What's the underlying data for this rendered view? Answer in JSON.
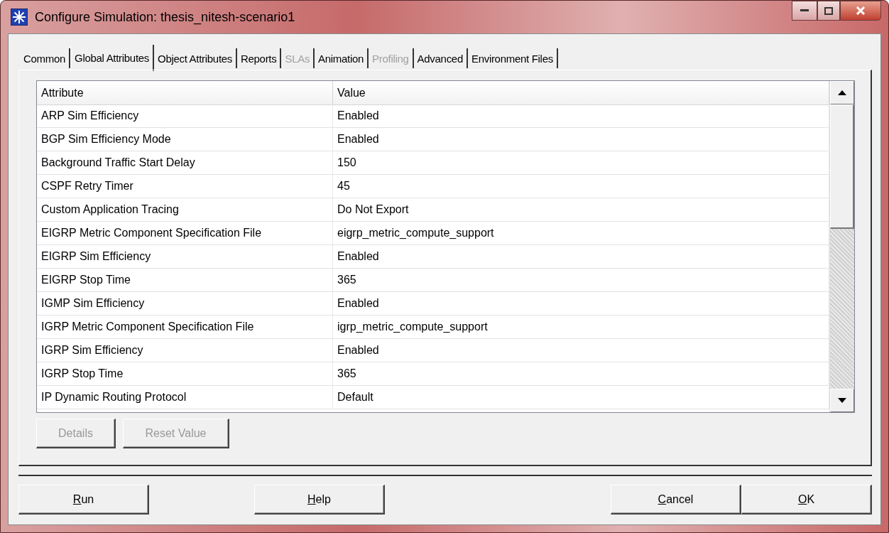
{
  "window": {
    "title": "Configure Simulation: thesis_nitesh-scenario1"
  },
  "tabs": [
    {
      "label": "Common",
      "selected": false,
      "disabled": false
    },
    {
      "label": "Global Attributes",
      "selected": true,
      "disabled": false
    },
    {
      "label": "Object Attributes",
      "selected": false,
      "disabled": false
    },
    {
      "label": "Reports",
      "selected": false,
      "disabled": false
    },
    {
      "label": "SLAs",
      "selected": false,
      "disabled": true
    },
    {
      "label": "Animation",
      "selected": false,
      "disabled": false
    },
    {
      "label": "Profiling",
      "selected": false,
      "disabled": true
    },
    {
      "label": "Advanced",
      "selected": false,
      "disabled": false
    },
    {
      "label": "Environment Files",
      "selected": false,
      "disabled": false
    }
  ],
  "table": {
    "columns": [
      "Attribute",
      "Value"
    ],
    "rows": [
      [
        "ARP Sim Efficiency",
        "Enabled"
      ],
      [
        "BGP Sim Efficiency Mode",
        "Enabled"
      ],
      [
        "Background Traffic Start Delay",
        "150"
      ],
      [
        "CSPF Retry Timer",
        "45"
      ],
      [
        "Custom Application Tracing",
        "Do Not Export"
      ],
      [
        "EIGRP Metric Component Specification File",
        "eigrp_metric_compute_support"
      ],
      [
        "EIGRP Sim Efficiency",
        "Enabled"
      ],
      [
        "EIGRP Stop Time",
        "365"
      ],
      [
        "IGMP Sim Efficiency",
        "Enabled"
      ],
      [
        "IGRP Metric Component Specification File",
        "igrp_metric_compute_support"
      ],
      [
        "IGRP Sim Efficiency",
        "Enabled"
      ],
      [
        "IGRP Stop Time",
        "365"
      ],
      [
        "IP Dynamic Routing Protocol",
        "Default"
      ]
    ]
  },
  "table_buttons": [
    {
      "label": "Details",
      "disabled": true
    },
    {
      "label": "Reset Value",
      "disabled": true
    }
  ],
  "footer_buttons": [
    {
      "label": "Run"
    },
    {
      "label": "Help"
    },
    {
      "label": "Cancel"
    },
    {
      "label": "OK"
    }
  ]
}
